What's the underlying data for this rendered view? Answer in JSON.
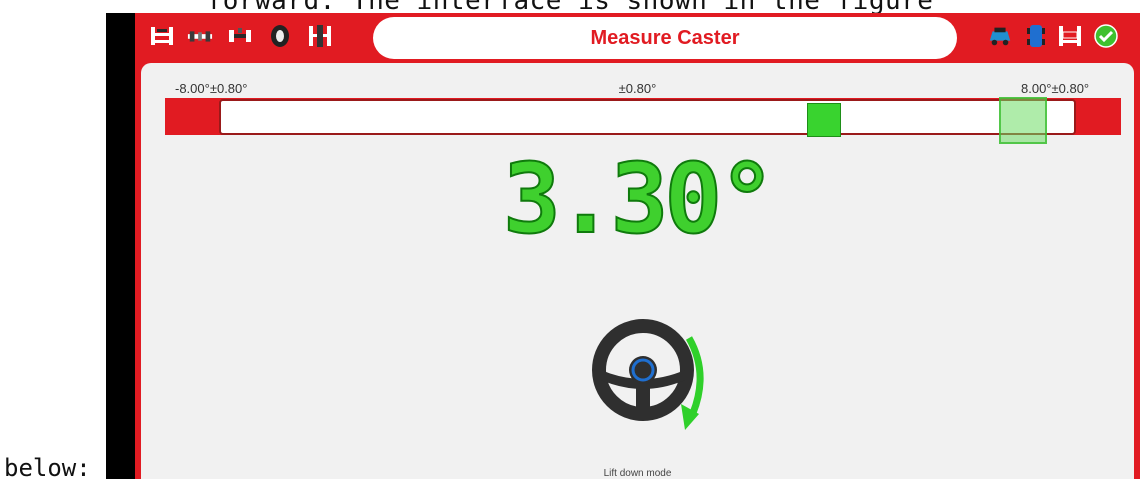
{
  "document": {
    "top_caption": "forward. The interface is shown in the figure",
    "left_caption": "below:"
  },
  "app": {
    "title": "Measure Caster",
    "mode_text": "Lift down mode",
    "accent_color": "#e11b22",
    "ok_color": "#3fd02e"
  },
  "toolbar": {
    "left_icons": [
      "lift-icon",
      "axle-icon",
      "vehicle-top-icon",
      "tire-icon",
      "alignment-icon"
    ],
    "right_icons": [
      "car-color-icon",
      "car-blue-icon",
      "lift-red-icon",
      "confirm-check-icon"
    ]
  },
  "gauge": {
    "left_tolerance": "-8.00°±0.80°",
    "center_tolerance": "±0.80°",
    "right_tolerance": "8.00°±0.80°",
    "value_text": "3.30°",
    "value": 3.3,
    "range_min": -8.0,
    "range_max": 8.0,
    "target": 8.0
  },
  "instruction": {
    "icon": "steering-wheel-icon",
    "direction": "turn-right-arrow-icon"
  }
}
